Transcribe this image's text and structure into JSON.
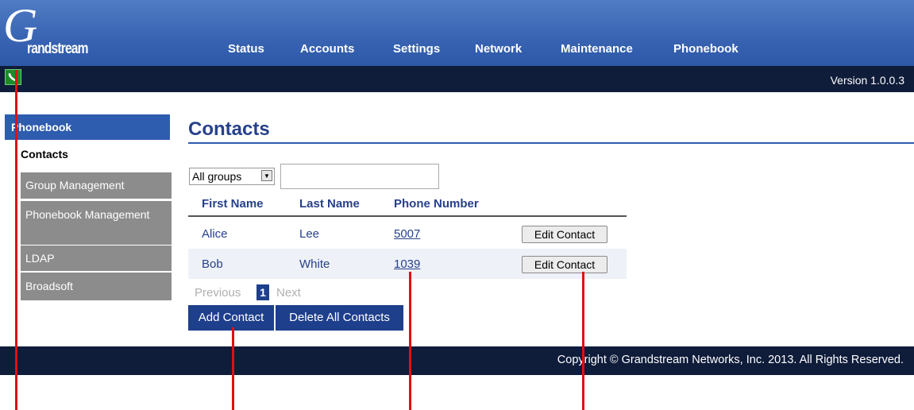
{
  "brand": {
    "logo_letter": "G",
    "logo_text": "randstream"
  },
  "nav": [
    "Status",
    "Accounts",
    "Settings",
    "Network",
    "Maintenance",
    "Phonebook"
  ],
  "version": "Version 1.0.0.3",
  "sidebar": {
    "title": "Phonebook",
    "active": "Contacts",
    "items": [
      {
        "label": "Group Management"
      },
      {
        "label": "Phonebook Management"
      },
      {
        "label": "LDAP"
      },
      {
        "label": "Broadsoft"
      }
    ]
  },
  "content": {
    "title": "Contacts",
    "filter": {
      "selected": "All groups",
      "search_value": ""
    },
    "table": {
      "headers": [
        "First Name",
        "Last Name",
        "Phone Number"
      ],
      "rows": [
        {
          "first": "Alice",
          "last": "Lee",
          "phone": "5007",
          "action": "Edit Contact"
        },
        {
          "first": "Bob",
          "last": "White",
          "phone": "1039",
          "action": "Edit Contact"
        }
      ]
    },
    "pagination": {
      "prev": "Previous",
      "page": "1",
      "next": "Next"
    },
    "buttons": {
      "add": "Add Contact",
      "delete_all": "Delete All Contacts"
    }
  },
  "footer": {
    "copyright": "Copyright © Grandstream Networks, Inc. 2013. All Rights Reserved."
  },
  "colors": {
    "header_blue": "#3a65b3",
    "dark_bar": "#0f1c3a",
    "sidebar_gray": "#8c8c8c",
    "accent": "#1e3f8c",
    "annotation_red": "#e01010"
  }
}
